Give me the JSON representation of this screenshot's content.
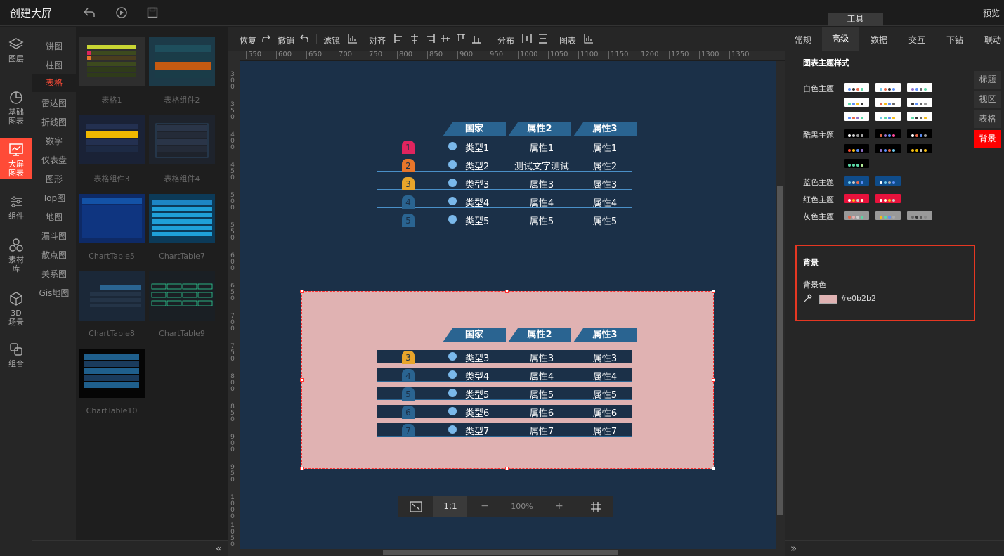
{
  "app": {
    "title": "创建大屏",
    "preview_label": "预览",
    "tools_label": "工具"
  },
  "nav": [
    {
      "label": "图层",
      "icon": "layers-icon"
    },
    {
      "label": "基础图表",
      "icon": "pie-chart-icon"
    },
    {
      "label": "大屏图表",
      "icon": "screen-chart-icon",
      "active": true
    },
    {
      "label": "组件",
      "icon": "sliders-icon"
    },
    {
      "label": "素材库",
      "icon": "material-icon"
    },
    {
      "label": "3D场景",
      "icon": "cube-icon"
    },
    {
      "label": "组合",
      "icon": "group-icon"
    }
  ],
  "categories": [
    "饼图",
    "柱图",
    "表格",
    "雷达图",
    "折线图",
    "数字",
    "仪表盘",
    "图形",
    "Top图",
    "地图",
    "漏斗图",
    "散点图",
    "关系图",
    "Gis地图"
  ],
  "active_category": "表格",
  "thumbnails": [
    "表格1",
    "表格组件2",
    "表格组件3",
    "表格组件4",
    "ChartTable5",
    "ChartTable7",
    "ChartTable8",
    "ChartTable9",
    "ChartTable10"
  ],
  "toolbar": {
    "redo": "恢复",
    "undo": "撤销",
    "filter": "滤镜",
    "align": "对齐",
    "distribute": "分布",
    "chart": "图表"
  },
  "ruler_top": [
    "550",
    "600",
    "650",
    "700",
    "750",
    "800",
    "850",
    "900",
    "950",
    "1000",
    "1050",
    "1100",
    "1150",
    "1200",
    "1250",
    "1300",
    "1350"
  ],
  "ruler_left": [
    "300",
    "350",
    "400",
    "450",
    "500",
    "550",
    "600",
    "650",
    "700",
    "750",
    "800",
    "850",
    "900",
    "950",
    "1000",
    "1050"
  ],
  "table1": {
    "headers": [
      "国家",
      "属性2",
      "属性3"
    ],
    "rows": [
      {
        "rank": "1",
        "type": "类型1",
        "a2": "属性1",
        "a3": "属性1",
        "color": "#e0245e"
      },
      {
        "rank": "2",
        "type": "类型2",
        "a2": "测试文字测试",
        "a3": "属性2",
        "color": "#e8762b"
      },
      {
        "rank": "3",
        "type": "类型3",
        "a2": "属性3",
        "a3": "属性3",
        "color": "#e8a52b"
      },
      {
        "rank": "4",
        "type": "类型4",
        "a2": "属性4",
        "a3": "属性4",
        "color": "#2a6491"
      },
      {
        "rank": "5",
        "type": "类型5",
        "a2": "属性5",
        "a3": "属性5",
        "color": "#2a6491"
      }
    ]
  },
  "table2": {
    "headers": [
      "国家",
      "属性2",
      "属性3"
    ],
    "rows": [
      {
        "rank": "3",
        "type": "类型3",
        "a2": "属性3",
        "a3": "属性3",
        "color": "#e8a52b"
      },
      {
        "rank": "4",
        "type": "类型4",
        "a2": "属性4",
        "a3": "属性4",
        "color": "#2a6491"
      },
      {
        "rank": "5",
        "type": "类型5",
        "a2": "属性5",
        "a3": "属性5",
        "color": "#2a6491"
      },
      {
        "rank": "6",
        "type": "类型6",
        "a2": "属性6",
        "a3": "属性6",
        "color": "#2a6491"
      },
      {
        "rank": "7",
        "type": "类型7",
        "a2": "属性7",
        "a3": "属性7",
        "color": "#2a6491"
      }
    ]
  },
  "zoom": {
    "ratio_label": "1:1",
    "minus": "−",
    "value": "100%",
    "plus": "+"
  },
  "right_tabs": [
    "常规",
    "高级",
    "数据",
    "交互",
    "下钻",
    "联动"
  ],
  "active_right_tab": "高级",
  "theme_section_title": "图表主题样式",
  "themes": {
    "white": "白色主题",
    "black": "酷黑主题",
    "blue": "蓝色主题",
    "red": "红色主题",
    "gray": "灰色主题"
  },
  "side_tabs": [
    "标题",
    "视区",
    "表格",
    "背景"
  ],
  "active_side_tab": "背景",
  "background": {
    "title": "背景",
    "color_label": "背景色",
    "color_value": "#e0b2b2"
  }
}
